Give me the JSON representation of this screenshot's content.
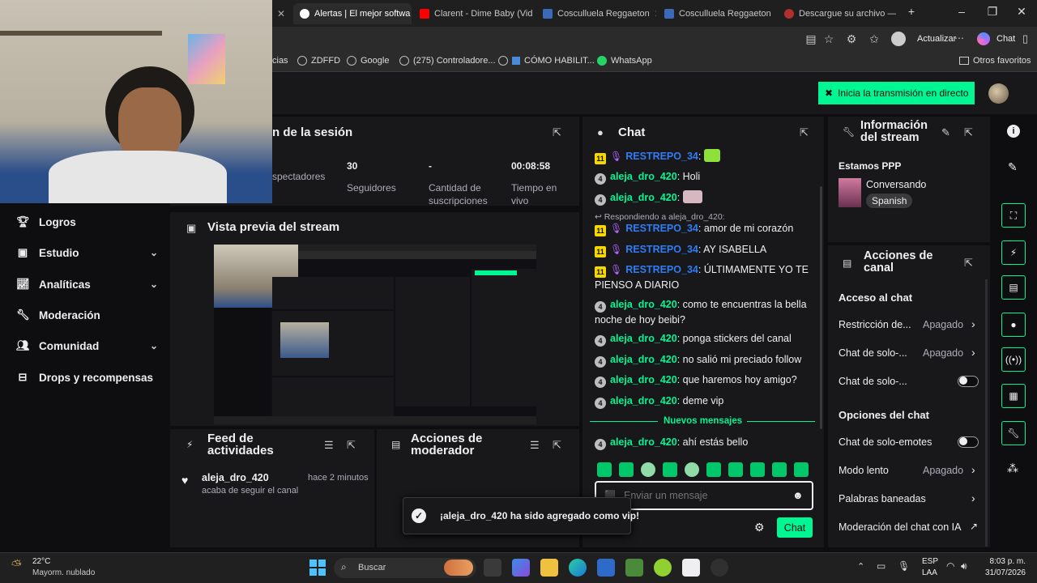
{
  "browser": {
    "tabs": [
      {
        "label": "d",
        "active": false
      },
      {
        "label": "Alertas | El mejor softwa",
        "active": true
      },
      {
        "label": "Clarent - Dime Baby (Vid",
        "active": false
      },
      {
        "label": "Cosculluela Reggaeton",
        "active": false
      },
      {
        "label": "Cosculluela Reggaeton",
        "active": false
      },
      {
        "label": "Descargue su archivo —",
        "active": false
      }
    ],
    "update_label": "Actualizar",
    "copilot_label": "Chat",
    "bookmarks": [
      "cias",
      "ZDFFD",
      "Google",
      "(275) Controladore...",
      "CÓMO HABILIT...",
      "WhatsApp"
    ],
    "other_favorites": "Otros favoritos"
  },
  "topbar": {
    "go_live_label": "Inicia la transmisión en directo"
  },
  "sidebar": {
    "items": [
      {
        "label": "Logros",
        "expandable": false
      },
      {
        "label": "Estudio",
        "expandable": true
      },
      {
        "label": "Analíticas",
        "expandable": true
      },
      {
        "label": "Moderación",
        "expandable": false
      },
      {
        "label": "Comunidad",
        "expandable": true
      },
      {
        "label": "Drops y recompensas",
        "expandable": false
      }
    ]
  },
  "session": {
    "title": "n de la sesión",
    "stats": [
      {
        "value": "",
        "label": "spectadores"
      },
      {
        "value": "30",
        "label": "Seguidores"
      },
      {
        "value": "-",
        "label": "Cantidad de suscripciones"
      },
      {
        "value": "00:08:58",
        "label": "Tiempo en vivo"
      }
    ]
  },
  "preview": {
    "title": "Vista previa del stream"
  },
  "activity": {
    "title": "Feed de actividades",
    "items": [
      {
        "user": "aleja_dro_420",
        "time": "hace 2 minutos",
        "text": "acaba de seguir el canal"
      }
    ]
  },
  "mod_actions": {
    "title": "Acciones de moderador"
  },
  "toast": {
    "text": "¡aleja_dro_420 ha sido agregado como vip!"
  },
  "chat": {
    "title": "Chat",
    "messages": [
      {
        "badge": "11",
        "user": "RESTREPO_34",
        "color": "blue",
        "text": ""
      },
      {
        "badge": "4",
        "user": "aleja_dro_420",
        "color": "green",
        "text": "Holi"
      },
      {
        "badge": "4",
        "user": "aleja_dro_420",
        "color": "green",
        "text": ""
      },
      {
        "badge": "11",
        "user": "RESTREPO_34",
        "color": "blue",
        "text": "amor de mi corazón"
      },
      {
        "badge": "11",
        "user": "RESTREPO_34",
        "color": "blue",
        "text": "AY ISABELLA"
      },
      {
        "badge": "11",
        "user": "RESTREPO_34",
        "color": "blue",
        "text": "ÚLTIMAMENTE YO TE PIENSO A DIARIO"
      },
      {
        "badge": "4",
        "user": "aleja_dro_420",
        "color": "green",
        "text": "como te encuentras la bella noche de hoy beibi?"
      },
      {
        "badge": "4",
        "user": "aleja_dro_420",
        "color": "green",
        "text": "ponga stickers del canal"
      },
      {
        "badge": "4",
        "user": "aleja_dro_420",
        "color": "green",
        "text": "no salió mi preciado follow"
      },
      {
        "badge": "4",
        "user": "aleja_dro_420",
        "color": "green",
        "text": "que haremos hoy amigo?"
      },
      {
        "badge": "4",
        "user": "aleja_dro_420",
        "color": "green",
        "text": "deme vip"
      },
      {
        "badge": "4",
        "user": "aleja_dro_420",
        "color": "green",
        "text": "ahí estás bello"
      }
    ],
    "reply_to": "Respondiendo a aleja_dro_420:",
    "new_messages": "Nuevos mensajes",
    "input_placeholder": "Enviar un mensaje",
    "send_label": "Chat"
  },
  "stream_info": {
    "title": "Información del stream",
    "stream_title": "Estamos PPP",
    "category": "Conversando",
    "language": "Spanish"
  },
  "channel_actions": {
    "title": "Acciones de canal",
    "chat_access_heading": "Acceso al chat",
    "access_rows": [
      {
        "label": "Restricción de...",
        "value": "Apagado",
        "type": "chevron"
      },
      {
        "label": "Chat de solo-...",
        "value": "Apagado",
        "type": "chevron"
      },
      {
        "label": "Chat de solo-...",
        "value": "",
        "type": "toggle"
      }
    ],
    "chat_options_heading": "Opciones del chat",
    "option_rows": [
      {
        "label": "Chat de solo-emotes",
        "value": "",
        "type": "toggle"
      },
      {
        "label": "Modo lento",
        "value": "Apagado",
        "type": "chevron"
      },
      {
        "label": "Palabras baneadas",
        "value": "",
        "type": "chevron"
      },
      {
        "label": "Moderación del chat con IA",
        "value": "",
        "type": "external"
      }
    ]
  },
  "taskbar": {
    "weather_temp": "22°C",
    "weather_desc": "Mayorm. nublado",
    "search_placeholder": "Buscar",
    "lang": "ESP",
    "lang2": "LAA",
    "time": "8:03 p. m.",
    "date": "31/07/2026"
  },
  "colors": {
    "accent": "#00f593",
    "panel": "#18181b",
    "background": "#0e0e10",
    "blue_user": "#2e7cf6",
    "purple_mic": "#b565ff"
  }
}
